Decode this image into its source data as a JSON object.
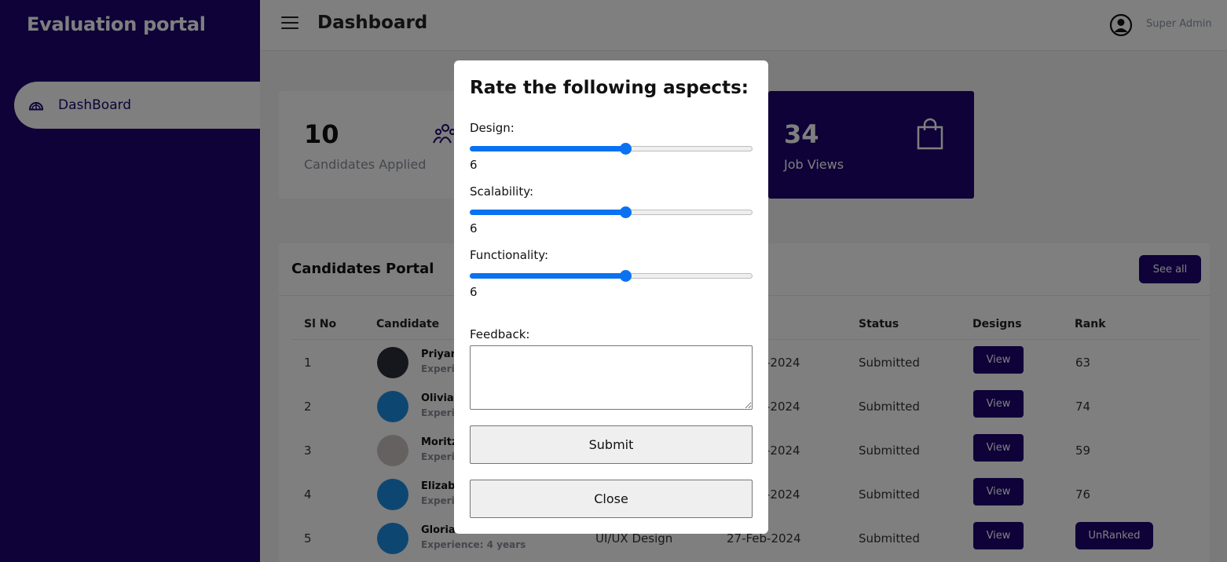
{
  "sidebar": {
    "brand": "Evaluation portal",
    "items": [
      {
        "label": "DashBoard",
        "icon": "dashboard-icon"
      }
    ]
  },
  "topbar": {
    "title": "Dashboard",
    "user": "Super Admin"
  },
  "stats": [
    {
      "value": "10",
      "label": "Candidates Applied",
      "icon": "users-icon"
    },
    {
      "value": "34",
      "label": "Job Views",
      "icon": "shopping-bag-icon"
    }
  ],
  "portal": {
    "title": "Candidates Portal",
    "see_all": "See all",
    "headers": {
      "sl": "Sl No",
      "candidate": "Candidate",
      "status": "Status",
      "designs": "Designs",
      "rank": "Rank"
    },
    "rows": [
      {
        "sl": "1",
        "name": "Priyan",
        "exp": "Experie",
        "date": "-2024",
        "status": "Submitted",
        "action": "View",
        "rank": "63"
      },
      {
        "sl": "2",
        "name": "Olivia",
        "exp": "Experie",
        "date": "-2024",
        "status": "Submitted",
        "action": "View",
        "rank": "74"
      },
      {
        "sl": "3",
        "name": "Moritz",
        "exp": "Experie",
        "date": "-2024",
        "status": "Submitted",
        "action": "View",
        "rank": "59"
      },
      {
        "sl": "4",
        "name": "Elizabe",
        "exp": "Experie",
        "date": "-2024",
        "status": "Submitted",
        "action": "View",
        "rank": "76"
      },
      {
        "sl": "5",
        "name": "Gloria",
        "exp": "Experience: 4 years",
        "role": "UI/UX Design",
        "date": "27-Feb-2024",
        "status": "Submitted",
        "action": "View",
        "rank": "UnRanked"
      }
    ]
  },
  "modal": {
    "title": "Rate the following aspects:",
    "sliders": [
      {
        "label": "Design:",
        "value": "6",
        "fraction": 0.55
      },
      {
        "label": "Scalability:",
        "value": "6",
        "fraction": 0.55
      },
      {
        "label": "Functionality:",
        "value": "6",
        "fraction": 0.55
      }
    ],
    "feedback_label": "Feedback:",
    "feedback_value": "",
    "submit": "Submit",
    "close": "Close"
  },
  "colors": {
    "brand": "#1c0570",
    "accent": "#0a72f0"
  }
}
